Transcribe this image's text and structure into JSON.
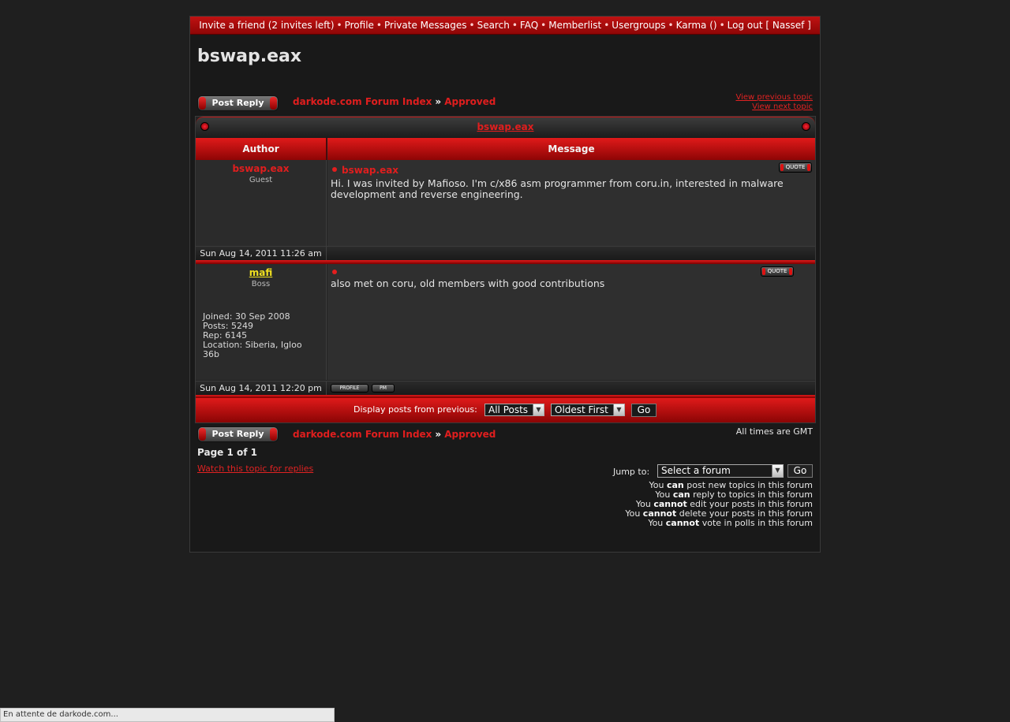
{
  "nav": {
    "items": [
      "Invite a friend (2 invites left)",
      "Profile",
      "Private Messages",
      "Search",
      "FAQ",
      "Memberlist",
      "Usergroups",
      "Karma ()",
      "Log out [ Nassef ]"
    ]
  },
  "page": {
    "title": "bswap.eax",
    "post_reply": "Post Reply",
    "breadcrumb": {
      "index": "darkode.com Forum Index",
      "sep": "»",
      "forum": "Approved"
    },
    "prev_topic": "View previous topic",
    "next_topic": "View next topic",
    "topic_title": "bswap.eax",
    "col_author": "Author",
    "col_message": "Message",
    "quote_label": "QUOTE",
    "profile_label": "PROFILE",
    "pm_label": "PM"
  },
  "posts": [
    {
      "author": "bswap.eax",
      "rank": "Guest",
      "subject": "bswap.eax",
      "body": "Hi. I was invited by Mafioso. I'm c/x86 asm programmer from coru.in, interested in malware development and reverse engineering.",
      "date": "Sun Aug 14, 2011 11:26 am"
    },
    {
      "author": "mafi",
      "rank": "Boss",
      "joined": "Joined: 30 Sep 2008",
      "posts": "Posts: 5249",
      "rep": "Rep: 6145",
      "location": "Location: Siberia, Igloo 36b",
      "subject": "",
      "body": "also met on coru, old members with good contributions",
      "date": "Sun Aug 14, 2011 12:20 pm"
    }
  ],
  "filter": {
    "label": "Display posts from previous:",
    "period": "All Posts",
    "order": "Oldest First",
    "go": "Go"
  },
  "footer": {
    "timezone": "All times are GMT",
    "page": "Page 1 of 1",
    "watch": "Watch this topic for replies",
    "jump_label": "Jump to:",
    "jump_value": "Select a forum",
    "jump_go": "Go",
    "perms": [
      {
        "pre": "You ",
        "word": "can",
        "post": " post new topics in this forum"
      },
      {
        "pre": "You ",
        "word": "can",
        "post": " reply to topics in this forum"
      },
      {
        "pre": "You ",
        "word": "cannot",
        "post": " edit your posts in this forum"
      },
      {
        "pre": "You ",
        "word": "cannot",
        "post": " delete your posts in this forum"
      },
      {
        "pre": "You ",
        "word": "cannot",
        "post": " vote in polls in this forum"
      }
    ]
  },
  "status": "En attente de darkode.com..."
}
